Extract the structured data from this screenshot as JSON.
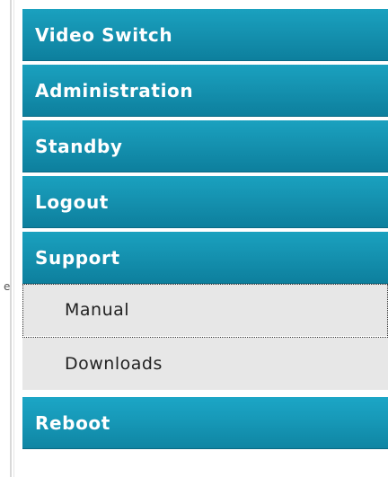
{
  "nav": {
    "items": [
      {
        "label": "Video Switch"
      },
      {
        "label": "Administration"
      },
      {
        "label": "Standby"
      },
      {
        "label": "Logout"
      },
      {
        "label": "Support"
      }
    ],
    "support_submenu": [
      {
        "label": "Manual",
        "focused": true
      },
      {
        "label": "Downloads"
      }
    ],
    "reboot": {
      "label": "Reboot"
    }
  },
  "stray_text": "e",
  "colors": {
    "menu_blue": "#1592b0",
    "menu_text": "#ffffff",
    "submenu_bg": "#e7e7e7",
    "submenu_text": "#222222"
  }
}
